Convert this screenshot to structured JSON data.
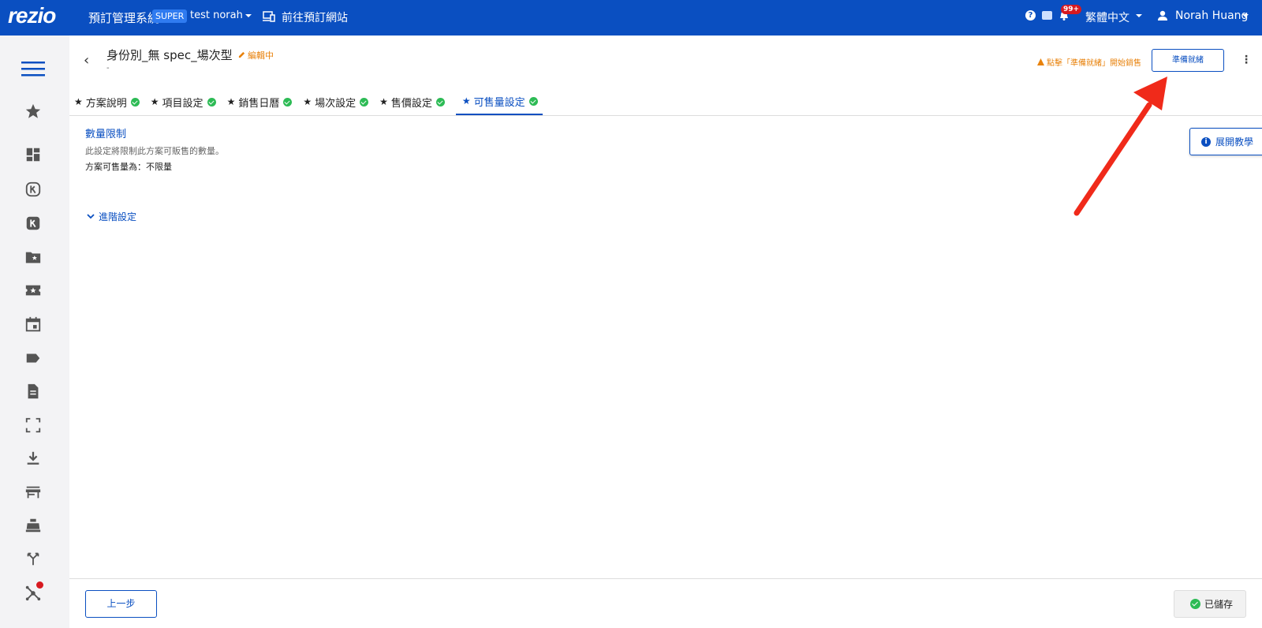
{
  "topbar": {
    "logo": "rezio",
    "system_title": "預訂管理系統",
    "role_badge": "SUPER",
    "account_name": "test norah",
    "site_link": "前往預訂網站",
    "notification_count": "99+",
    "language": "繁體中文",
    "user_name": "Norah Huang"
  },
  "sidebar": {
    "items": [
      {
        "icon": "menu-icon"
      },
      {
        "icon": "star-icon"
      },
      {
        "icon": "dashboard-icon"
      },
      {
        "icon": "k-outline-icon"
      },
      {
        "icon": "k-filled-icon"
      },
      {
        "icon": "folder-star-icon"
      },
      {
        "icon": "ticket-star-icon"
      },
      {
        "icon": "calendar-icon"
      },
      {
        "icon": "tag-icon"
      },
      {
        "icon": "document-icon"
      },
      {
        "icon": "scan-icon"
      },
      {
        "icon": "download-icon"
      },
      {
        "icon": "store-icon"
      },
      {
        "icon": "cash-register-icon"
      },
      {
        "icon": "split-arrow-icon"
      },
      {
        "icon": "network-icon"
      }
    ]
  },
  "header": {
    "back": "‹",
    "plan_title": "身份別_無 spec_場次型",
    "edit_status": "編輯中",
    "subtitle": "-",
    "warning": "點擊「準備就緒」開始銷售",
    "ready_button": "準備就緒",
    "more": "⋮"
  },
  "tabs": [
    {
      "label": "方案說明",
      "active": false
    },
    {
      "label": "項目設定",
      "active": false
    },
    {
      "label": "銷售日曆",
      "active": false
    },
    {
      "label": "場次設定",
      "active": false
    },
    {
      "label": "售價設定",
      "active": false
    },
    {
      "label": "可售量設定",
      "active": true
    }
  ],
  "content": {
    "section_title": "數量限制",
    "section_desc": "此設定將限制此方案可販售的數量。",
    "section_value": "方案可售量為：不限量",
    "advanced": "進階設定",
    "tutorial_button": "展開教學"
  },
  "footer": {
    "prev_button": "上一步",
    "saved_button": "已儲存"
  },
  "colors": {
    "primary": "#0a4fc1",
    "warning": "#e8820c",
    "success": "#2dbb55",
    "annotation_arrow": "#f02a1a"
  }
}
